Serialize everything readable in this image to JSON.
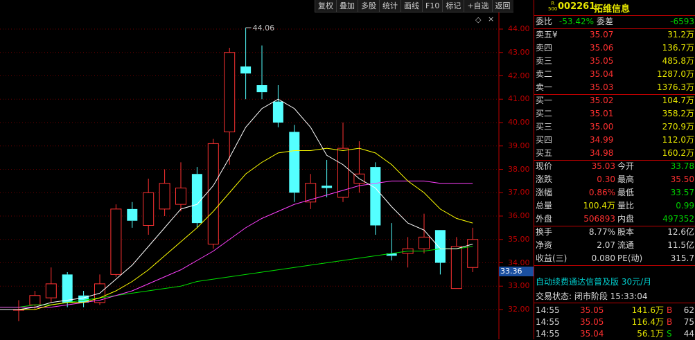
{
  "toolbar": {
    "items": [
      "复权",
      "叠加",
      "多股",
      "统计",
      "画线",
      "F10",
      "标记",
      "+自选",
      "返回"
    ]
  },
  "chart": {
    "max_label": "44.06",
    "current_price_label": "33.36",
    "yticks": [
      "44.00",
      "43.00",
      "42.00",
      "41.00",
      "40.00",
      "39.00",
      "38.00",
      "37.00",
      "36.00",
      "35.00",
      "34.00",
      "33.00",
      "32.00"
    ],
    "icons": {
      "diamond": "◇",
      "close": "×"
    },
    "colors": {
      "up": "#ff3232",
      "down": "#54ffff",
      "ma5": "#ffffff",
      "ma10": "#ffff00",
      "ma20": "#ff40ff",
      "ma60": "#00e000"
    }
  },
  "chart_data": {
    "type": "candlestick",
    "ylim": [
      31.6,
      44.4
    ],
    "candles": [
      {
        "o": 32.0,
        "c": 32.0,
        "h": 32.4,
        "l": 31.5
      },
      {
        "o": 32.2,
        "c": 32.6,
        "h": 32.8,
        "l": 32.0
      },
      {
        "o": 32.5,
        "c": 33.1,
        "h": 33.8,
        "l": 32.3
      },
      {
        "o": 33.5,
        "c": 32.3,
        "h": 33.6,
        "l": 32.1
      },
      {
        "o": 32.6,
        "c": 32.3,
        "h": 32.8,
        "l": 32.1
      },
      {
        "o": 32.3,
        "c": 33.1,
        "h": 33.5,
        "l": 32.2
      },
      {
        "o": 33.5,
        "c": 36.3,
        "h": 36.5,
        "l": 33.4
      },
      {
        "o": 36.3,
        "c": 35.8,
        "h": 36.6,
        "l": 35.5
      },
      {
        "o": 35.6,
        "c": 37.0,
        "h": 37.6,
        "l": 35.2
      },
      {
        "o": 36.3,
        "c": 37.4,
        "h": 38.0,
        "l": 36.0
      },
      {
        "o": 36.5,
        "c": 37.2,
        "h": 38.3,
        "l": 36.2
      },
      {
        "o": 37.8,
        "c": 35.7,
        "h": 38.1,
        "l": 35.5
      },
      {
        "o": 34.8,
        "c": 39.1,
        "h": 39.3,
        "l": 34.6
      },
      {
        "o": 39.6,
        "c": 43.0,
        "h": 43.2,
        "l": 38.2
      },
      {
        "o": 42.4,
        "c": 42.1,
        "h": 44.06,
        "l": 41.0
      },
      {
        "o": 41.6,
        "c": 41.3,
        "h": 43.3,
        "l": 41.0
      },
      {
        "o": 40.9,
        "c": 40.0,
        "h": 41.6,
        "l": 39.8
      },
      {
        "o": 39.6,
        "c": 37.0,
        "h": 39.9,
        "l": 36.6
      },
      {
        "o": 36.6,
        "c": 37.4,
        "h": 37.8,
        "l": 36.3
      },
      {
        "o": 37.3,
        "c": 37.2,
        "h": 38.4,
        "l": 36.8
      },
      {
        "o": 36.8,
        "c": 38.9,
        "h": 40.0,
        "l": 36.6
      },
      {
        "o": 37.4,
        "c": 37.8,
        "h": 39.2,
        "l": 37.0
      },
      {
        "o": 38.1,
        "c": 35.6,
        "h": 38.3,
        "l": 35.2
      },
      {
        "o": 34.4,
        "c": 34.3,
        "h": 35.7,
        "l": 34.1
      },
      {
        "o": 34.4,
        "c": 34.6,
        "h": 35.1,
        "l": 33.8
      },
      {
        "o": 34.6,
        "c": 35.1,
        "h": 36.1,
        "l": 34.4
      },
      {
        "o": 35.4,
        "c": 34.0,
        "h": 35.4,
        "l": 33.5
      },
      {
        "o": 32.9,
        "c": 34.7,
        "h": 35.1,
        "l": 32.9
      },
      {
        "o": 33.8,
        "c": 35.0,
        "h": 35.5,
        "l": 33.6
      }
    ],
    "ma5": [
      32.0,
      32.1,
      32.3,
      32.4,
      32.5,
      32.7,
      33.3,
      33.9,
      34.7,
      35.5,
      36.3,
      36.5,
      37.3,
      38.5,
      39.8,
      40.6,
      41.0,
      40.6,
      39.8,
      38.6,
      38.2,
      37.6,
      37.2,
      36.4,
      35.7,
      35.4,
      34.6,
      34.6,
      34.8
    ],
    "ma10": [
      32.0,
      32.0,
      32.2,
      32.3,
      32.3,
      32.5,
      32.8,
      33.2,
      33.7,
      34.3,
      34.9,
      35.5,
      36.2,
      37.0,
      37.8,
      38.3,
      38.7,
      38.8,
      38.8,
      38.9,
      38.8,
      38.9,
      38.7,
      38.2,
      37.5,
      37.0,
      36.3,
      35.9,
      35.7
    ],
    "ma20": [
      32.1,
      32.1,
      32.1,
      32.2,
      32.3,
      32.4,
      32.6,
      32.8,
      33.1,
      33.4,
      33.7,
      34.1,
      34.5,
      35.0,
      35.5,
      35.9,
      36.2,
      36.5,
      36.7,
      36.9,
      37.1,
      37.3,
      37.4,
      37.5,
      37.5,
      37.5,
      37.4,
      37.4,
      37.4
    ],
    "ma60": [
      32.1,
      32.2,
      32.2,
      32.3,
      32.4,
      32.5,
      32.6,
      32.7,
      32.8,
      32.9,
      33.0,
      33.2,
      33.3,
      33.4,
      33.5,
      33.6,
      33.7,
      33.8,
      33.9,
      34.0,
      34.1,
      34.2,
      34.3,
      34.4,
      34.5,
      34.5,
      34.6,
      34.6,
      34.7
    ]
  },
  "quote": {
    "badge_top": "R",
    "badge_bottom": "500",
    "code": "002261",
    "name": "拓维信息",
    "weibi_label": "委比",
    "weibi": "-53.42%",
    "weicha_label": "委差",
    "weicha": "-6593",
    "asks": [
      {
        "label": "卖五",
        "mark": "¥",
        "price": "35.07",
        "vol": "31.2万"
      },
      {
        "label": "卖四",
        "mark": "",
        "price": "35.06",
        "vol": "136.7万"
      },
      {
        "label": "卖三",
        "mark": "",
        "price": "35.05",
        "vol": "485.8万"
      },
      {
        "label": "卖二",
        "mark": "",
        "price": "35.04",
        "vol": "1287.0万"
      },
      {
        "label": "卖一",
        "mark": "",
        "price": "35.03",
        "vol": "1376.3万"
      }
    ],
    "bids": [
      {
        "label": "买一",
        "price": "35.02",
        "vol": "104.7万"
      },
      {
        "label": "买二",
        "price": "35.01",
        "vol": "358.2万"
      },
      {
        "label": "买三",
        "price": "35.00",
        "vol": "270.9万"
      },
      {
        "label": "买四",
        "price": "34.99",
        "vol": "112.0万"
      },
      {
        "label": "买五",
        "price": "34.98",
        "vol": "160.2万"
      }
    ],
    "stats": [
      {
        "l1": "现价",
        "v1": "35.03",
        "c1": "red",
        "l2": "今开",
        "v2": "33.78",
        "c2": "green"
      },
      {
        "l1": "涨跌",
        "v1": "0.30",
        "c1": "red",
        "l2": "最高",
        "v2": "35.50",
        "c2": "red"
      },
      {
        "l1": "涨幅",
        "v1": "0.86%",
        "c1": "red",
        "l2": "最低",
        "v2": "33.57",
        "c2": "green"
      },
      {
        "l1": "总量",
        "v1": "100.4万",
        "c1": "yellow",
        "l2": "量比",
        "v2": "0.99",
        "c2": "green"
      },
      {
        "l1": "外盘",
        "v1": "506893",
        "c1": "red",
        "l2": "内盘",
        "v2": "497352",
        "c2": "green"
      }
    ],
    "fin": [
      {
        "l1": "换手",
        "v1": "8.77%",
        "l2": "股本",
        "v2": "12.6亿"
      },
      {
        "l1": "净资",
        "v1": "2.07",
        "l2": "流通",
        "v2": "11.5亿"
      },
      {
        "l1": "收益(三)",
        "v1": "0.080",
        "l2": "PE(动)",
        "v2": "315.7"
      }
    ],
    "ad": "自动续费通达信普及版  30元/月",
    "status": "交易状态: 闭市阶段 15:33:04",
    "ticks": [
      {
        "time": "14:55",
        "price": "35.05",
        "vol": "141.6万",
        "side": "B",
        "n": "62"
      },
      {
        "time": "14:55",
        "price": "35.05",
        "vol": "116.4万",
        "side": "B",
        "n": "75"
      },
      {
        "time": "14:55",
        "price": "35.04",
        "vol": "56.1万",
        "side": "S",
        "n": "44"
      }
    ]
  }
}
